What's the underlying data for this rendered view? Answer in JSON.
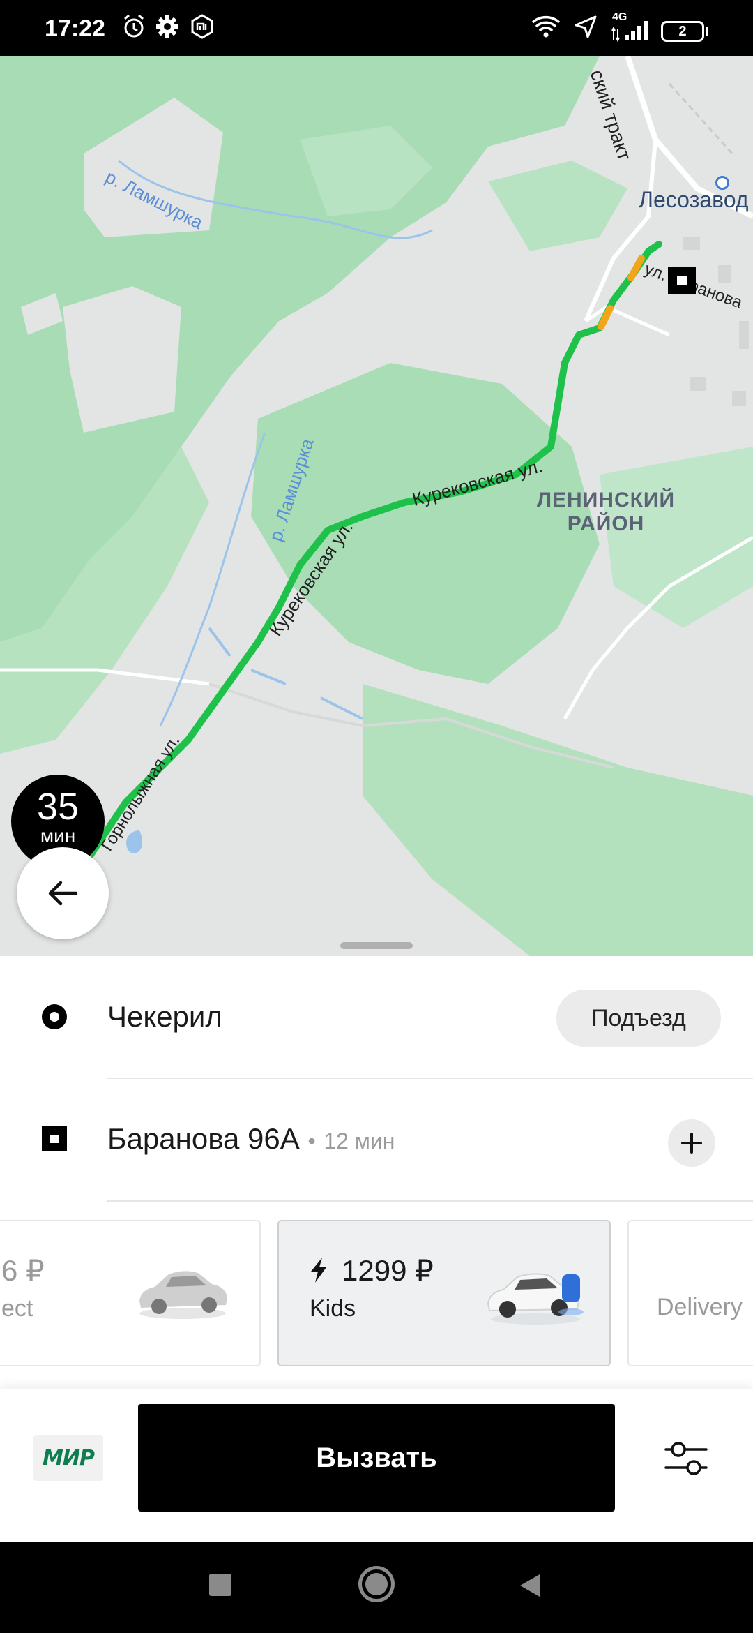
{
  "status_bar": {
    "time": "17:22",
    "network": "4G",
    "battery": "2"
  },
  "map": {
    "labels": {
      "river1": "р. Ламшурка",
      "river2": "р. Ламшурка",
      "road_tract": "ский тракт",
      "place": "Лесозавод",
      "street_baranova": "ул. Баранова",
      "street_kurekovskaya1": "Курековская ул.",
      "street_kurekovskaya2": "Курековская ул.",
      "street_gornolyzhnaya": "Горнолыжная ул.",
      "district_line1": "ЛЕНИНСКИЙ",
      "district_line2": "РАЙОН"
    },
    "eta": {
      "value": "35",
      "unit": "мин"
    },
    "route_color": "#1ec24a",
    "traffic_color": "#f2a51a"
  },
  "route": {
    "pickup": {
      "address": "Чекерил",
      "entrance_label": "Подъезд"
    },
    "destination": {
      "address": "Баранова 96А",
      "separator": "•",
      "duration": "12 мин"
    }
  },
  "tariffs": [
    {
      "price": "6 ₽",
      "name": "ect",
      "selected": false
    },
    {
      "price": "1299 ₽",
      "name": "Kids",
      "selected": true
    },
    {
      "price": "",
      "name": "Delivery",
      "selected": false
    }
  ],
  "bottom": {
    "payment_label": "МИР",
    "call_label": "Вызвать"
  },
  "icons": {
    "back": "arrow-left-icon",
    "options": "sliders-icon",
    "add_stop": "plus-icon",
    "bolt": "lightning-icon"
  }
}
